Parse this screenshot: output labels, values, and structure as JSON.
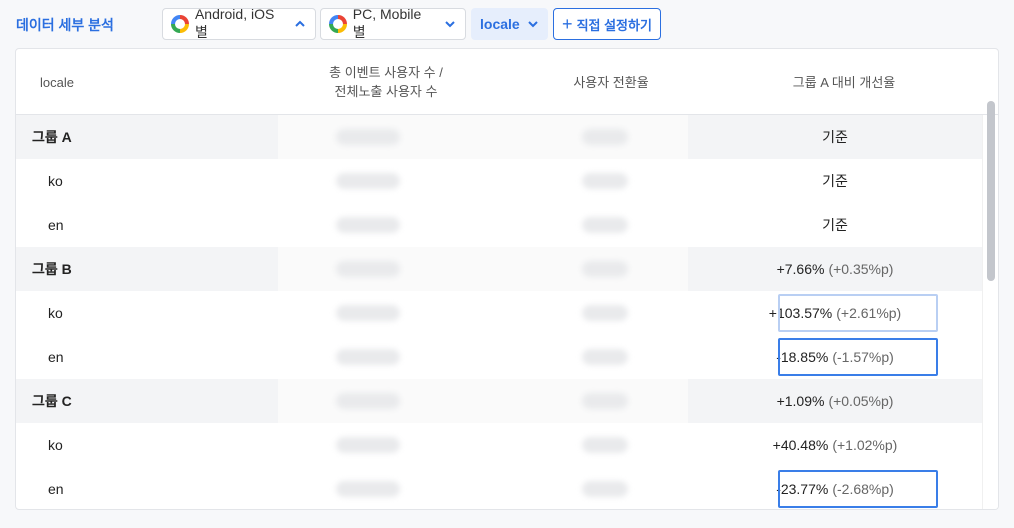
{
  "toolbar": {
    "title": "데이터 세부 분석",
    "chips": [
      {
        "label": "Android, iOS별",
        "icon": "ring-logo-icon",
        "chevron": "up"
      },
      {
        "label": "PC, Mobile 별",
        "icon": "ring-logo-icon",
        "chevron": "down"
      },
      {
        "label": "locale",
        "chevron": "down",
        "active": true
      }
    ],
    "custom_button": "직접 설정하기"
  },
  "table": {
    "headers": [
      "locale",
      "총 이벤트 사용자 수 /",
      "전체노출 사용자 수",
      "사용자 전환율",
      "그룹 A 대비 개선율"
    ],
    "rows": [
      {
        "type": "group",
        "label": "그룹 A",
        "ratio": "기준",
        "ratio_sub": ""
      },
      {
        "type": "sub",
        "label": "ko",
        "ratio": "기준",
        "ratio_sub": ""
      },
      {
        "type": "sub",
        "label": "en",
        "ratio": "기준",
        "ratio_sub": ""
      },
      {
        "type": "group",
        "label": "그룹 B",
        "ratio": "+7.66%",
        "ratio_sub": "(+0.35%p)"
      },
      {
        "type": "sub",
        "label": "ko",
        "ratio": "+103.57%",
        "ratio_sub": "(+2.61%p)",
        "highlight": "light"
      },
      {
        "type": "sub",
        "label": "en",
        "ratio": "-18.85%",
        "ratio_sub": "(-1.57%p)",
        "highlight": "strong"
      },
      {
        "type": "group",
        "label": "그룹 C",
        "ratio": "+1.09%",
        "ratio_sub": "(+0.05%p)"
      },
      {
        "type": "sub",
        "label": "ko",
        "ratio": "+40.48%",
        "ratio_sub": "(+1.02%p)"
      },
      {
        "type": "sub",
        "label": "en",
        "ratio": "-23.77%",
        "ratio_sub": "(-2.68%p)",
        "highlight": "strong"
      }
    ]
  },
  "colors": {
    "accent": "#2b6fe0",
    "highlight_strong": "#3a7ee8",
    "highlight_light": "#b9cff3"
  }
}
